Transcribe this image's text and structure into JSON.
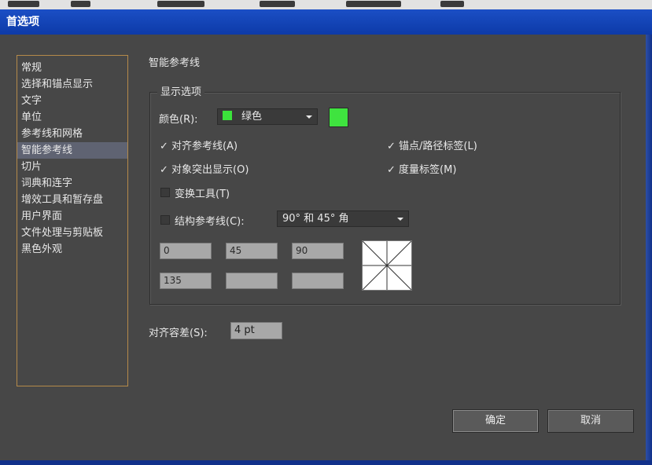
{
  "window": {
    "title": "首选项"
  },
  "sidebar": {
    "items": [
      {
        "label": "常规"
      },
      {
        "label": "选择和锚点显示"
      },
      {
        "label": "文字"
      },
      {
        "label": "单位"
      },
      {
        "label": "参考线和网格"
      },
      {
        "label": "智能参考线",
        "selected": true
      },
      {
        "label": "切片"
      },
      {
        "label": "词典和连字"
      },
      {
        "label": "增效工具和暂存盘"
      },
      {
        "label": "用户界面"
      },
      {
        "label": "文件处理与剪贴板"
      },
      {
        "label": "黑色外观"
      }
    ]
  },
  "section": {
    "title": "智能参考线"
  },
  "display_options": {
    "group_title": "显示选项",
    "color_label": "颜色(R):",
    "color_value": "绿色",
    "color_hex": "#3fe33f",
    "align_guides": {
      "label": "对齐参考线(A)",
      "checked": true
    },
    "anchor_path_labels": {
      "label": "锚点/路径标签(L)",
      "checked": true
    },
    "object_highlighting": {
      "label": "对象突出显示(O)",
      "checked": true
    },
    "measurement_labels": {
      "label": "度量标签(M)",
      "checked": true
    },
    "transform_tools": {
      "label": "变换工具(T)",
      "checked": false
    },
    "construction_guides": {
      "label": "结构参考线(C):",
      "checked": false,
      "value": "90° 和 45° 角"
    },
    "angles": [
      "0",
      "45",
      "90",
      "135",
      "",
      ""
    ]
  },
  "snapping_tolerance": {
    "label": "对齐容差(S):",
    "value": "4 pt"
  },
  "buttons": {
    "ok": "确定",
    "cancel": "取消"
  },
  "check_glyph": "✓"
}
